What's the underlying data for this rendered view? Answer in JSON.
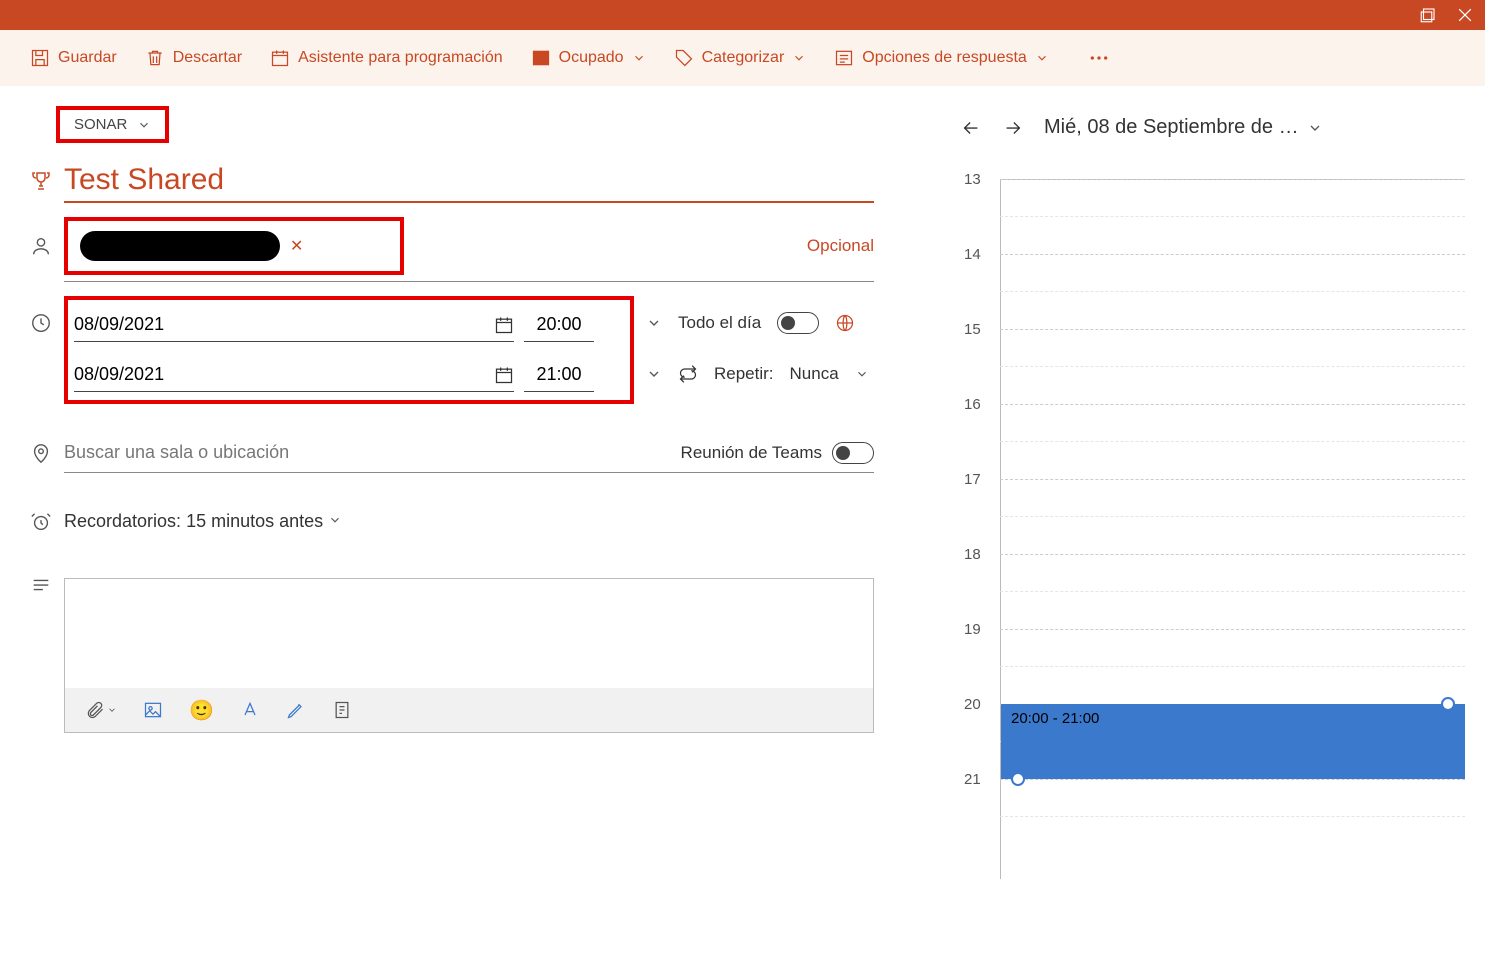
{
  "titlebar": {},
  "ribbon": {
    "save": "Guardar",
    "discard": "Descartar",
    "scheduling": "Asistente para programación",
    "busy": "Ocupado",
    "categorize": "Categorizar",
    "response": "Opciones de respuesta"
  },
  "calendar_picker": "SONAR",
  "event": {
    "title": "Test Shared",
    "optional_label": "Opcional",
    "start_date": "08/09/2021",
    "start_time": "20:00",
    "end_date": "08/09/2021",
    "end_time": "21:00",
    "all_day_label": "Todo el día",
    "repeat_label": "Repetir:",
    "repeat_value": "Nunca",
    "location_placeholder": "Buscar una sala o ubicación",
    "teams_label": "Reunión de Teams",
    "reminder_label": "Recordatorios:",
    "reminder_value": "15 minutos antes"
  },
  "right": {
    "date_label": "Mié, 08 de Septiembre de …",
    "hours": [
      "13",
      "14",
      "15",
      "16",
      "17",
      "18",
      "19",
      "20",
      "21"
    ],
    "event_label": "20:00 - 21:00"
  }
}
